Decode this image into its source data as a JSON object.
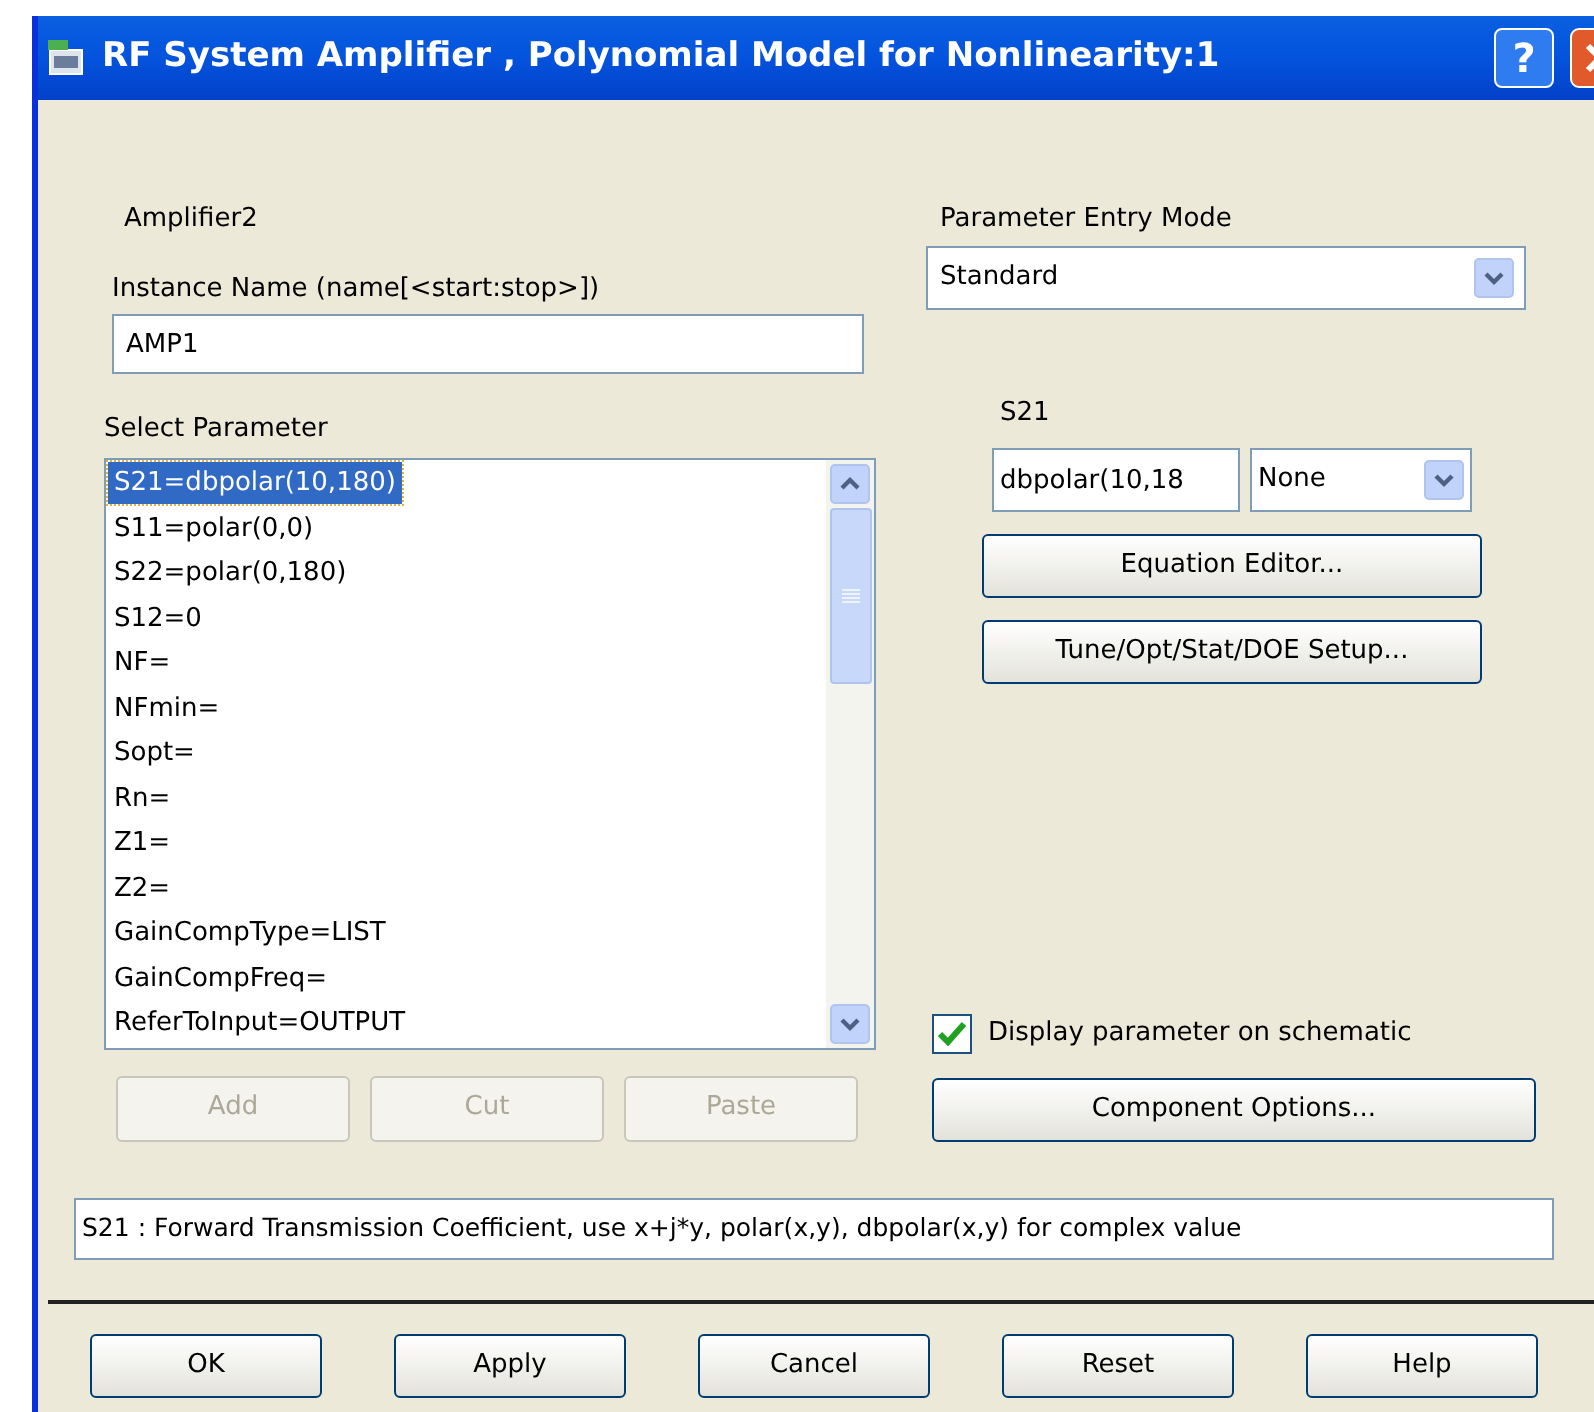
{
  "window": {
    "title": "RF System Amplifier , Polynomial Model for Nonlinearity:1",
    "help_glyph": "?"
  },
  "component_label": "Amplifier2",
  "instance_name": {
    "label": "Instance Name  (name[<start:stop>])",
    "value": "AMP1"
  },
  "select_parameter": {
    "label": "Select Parameter",
    "items": [
      {
        "text": "S21=dbpolar(10,180)",
        "selected": true
      },
      {
        "text": "S11=polar(0,0)",
        "selected": false
      },
      {
        "text": "S22=polar(0,180)",
        "selected": false
      },
      {
        "text": "S12=0",
        "selected": false
      },
      {
        "text": "NF=",
        "selected": false
      },
      {
        "text": "NFmin=",
        "selected": false
      },
      {
        "text": "Sopt=",
        "selected": false
      },
      {
        "text": "Rn=",
        "selected": false
      },
      {
        "text": "Z1=",
        "selected": false
      },
      {
        "text": "Z2=",
        "selected": false
      },
      {
        "text": "GainCompType=LIST",
        "selected": false
      },
      {
        "text": "GainCompFreq=",
        "selected": false
      },
      {
        "text": "ReferToInput=OUTPUT",
        "selected": false
      }
    ]
  },
  "list_buttons": [
    {
      "label": "Add",
      "disabled": true
    },
    {
      "label": "Cut",
      "disabled": true
    },
    {
      "label": "Paste",
      "disabled": true
    }
  ],
  "parameter_entry_mode": {
    "label": "Parameter Entry Mode",
    "value": "Standard"
  },
  "parameter_editor": {
    "label": "S21",
    "value": "dbpolar(10,18",
    "unit": "None"
  },
  "editor_buttons": [
    {
      "label": "Equation Editor..."
    },
    {
      "label": "Tune/Opt/Stat/DOE Setup..."
    }
  ],
  "display_on_schematic": {
    "label": "Display parameter on schematic",
    "checked": true
  },
  "component_options": {
    "label": "Component Options..."
  },
  "description": "S21 : Forward Transmission Coefficient, use x+j*y, polar(x,y), dbpolar(x,y) for complex value",
  "dialog_buttons": [
    {
      "label": "OK"
    },
    {
      "label": "Apply"
    },
    {
      "label": "Cancel"
    },
    {
      "label": "Reset"
    },
    {
      "label": "Help"
    }
  ]
}
